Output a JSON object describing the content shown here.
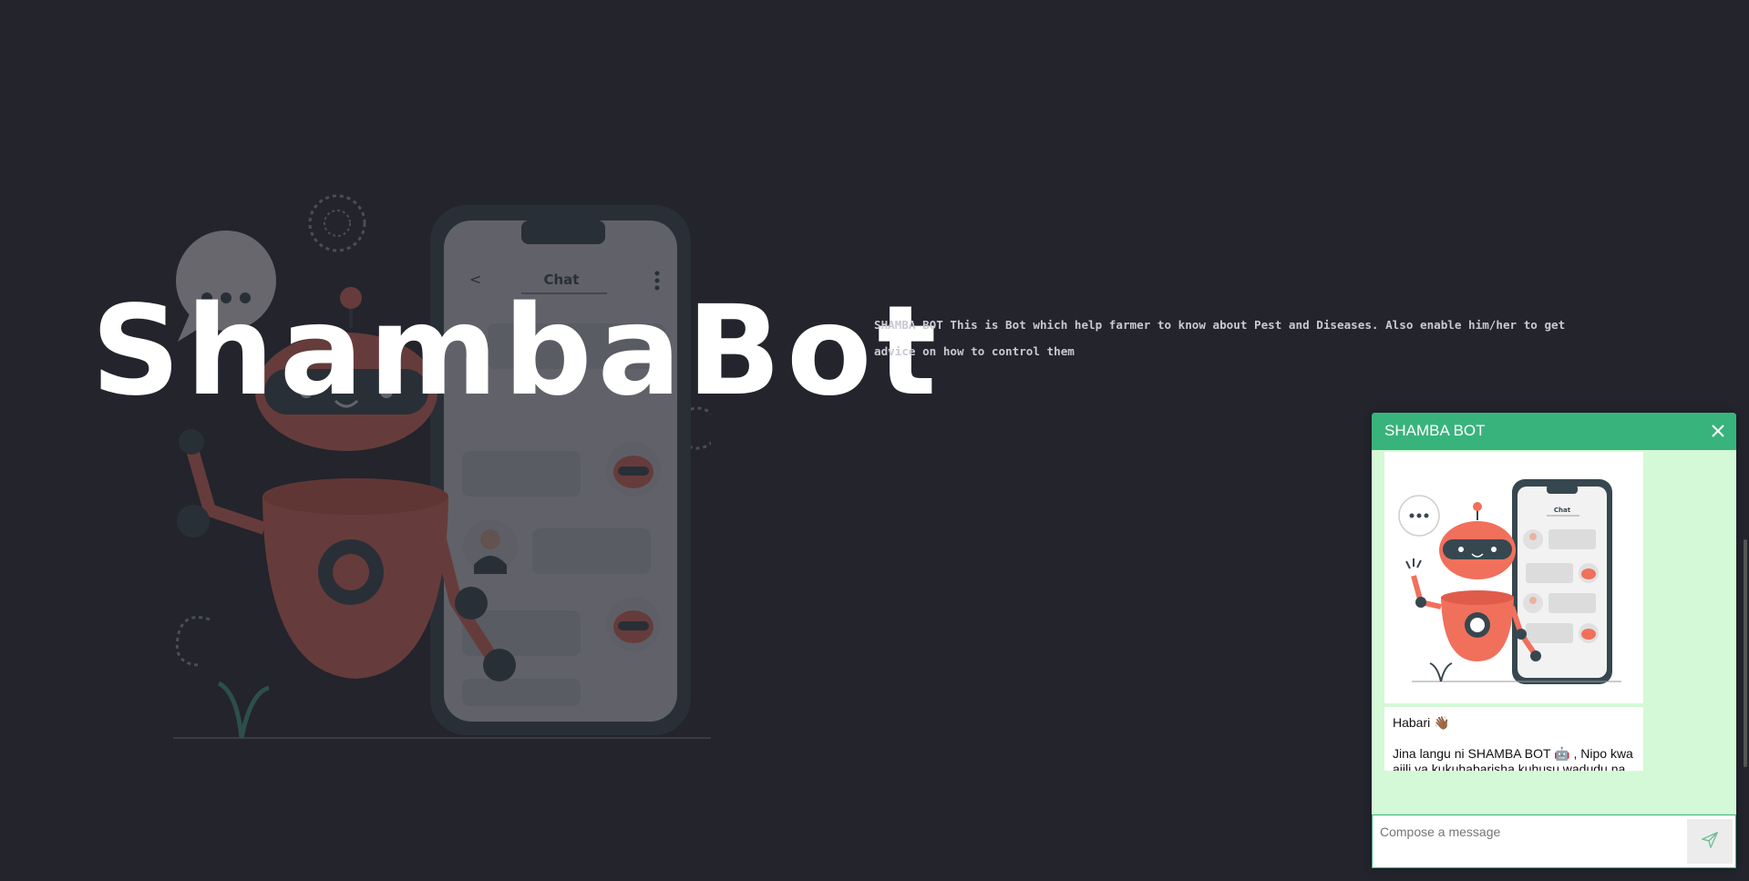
{
  "hero": {
    "title": "ShambaBot",
    "description": "SHAMBA BOT This is Bot which help farmer to know about Pest and Diseases. Also enable him/her to get advice on how to control them",
    "illustration_phone_title": "Chat",
    "illustration_icon": "robot-chat-illustration"
  },
  "chat": {
    "title": "SHAMBA BOT",
    "close_icon": "close-icon",
    "image_phone_title": "Chat",
    "greeting": "Habari 👋🏾",
    "intro": "Jina langu ni SHAMBA BOT 🤖 , Nipo kwa ajili ya kukuhabarisha kuhusu wadudu na magonjwa  na kukupa ushauri wa kilimo",
    "compose_placeholder": "Compose a message",
    "send_icon": "send-icon"
  },
  "colors": {
    "background": "#23242c",
    "accent": "#38b37c",
    "chat_bg": "#d4f9d6",
    "robot": "#f0705c"
  }
}
